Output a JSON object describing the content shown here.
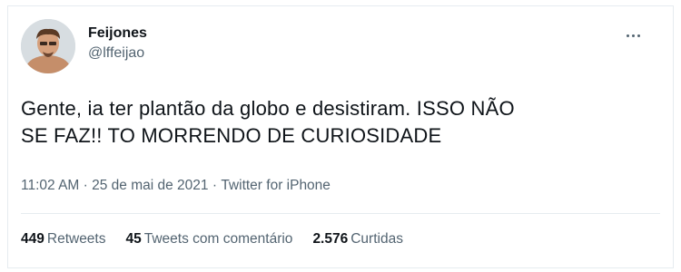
{
  "author": {
    "name": "Feijones",
    "handle": "@lffeijao"
  },
  "tweet": {
    "text": "Gente, ia ter plantão da globo e desistiram. ISSO NÃO\nSE FAZ!! TO MORRENDO DE CURIOSIDADE"
  },
  "meta": {
    "time": "11:02 AM",
    "separator": " · ",
    "date": "25 de mai de 2021",
    "source": "Twitter for iPhone"
  },
  "stats": [
    {
      "count": "449",
      "label": "Retweets"
    },
    {
      "count": "45",
      "label": "Tweets com comentário"
    },
    {
      "count": "2.576",
      "label": "Curtidas"
    }
  ],
  "colors": {
    "primary_text": "#0f1419",
    "secondary_text": "#536471",
    "border": "#e6ecf0"
  },
  "icons": {
    "more": "more-options-icon"
  }
}
